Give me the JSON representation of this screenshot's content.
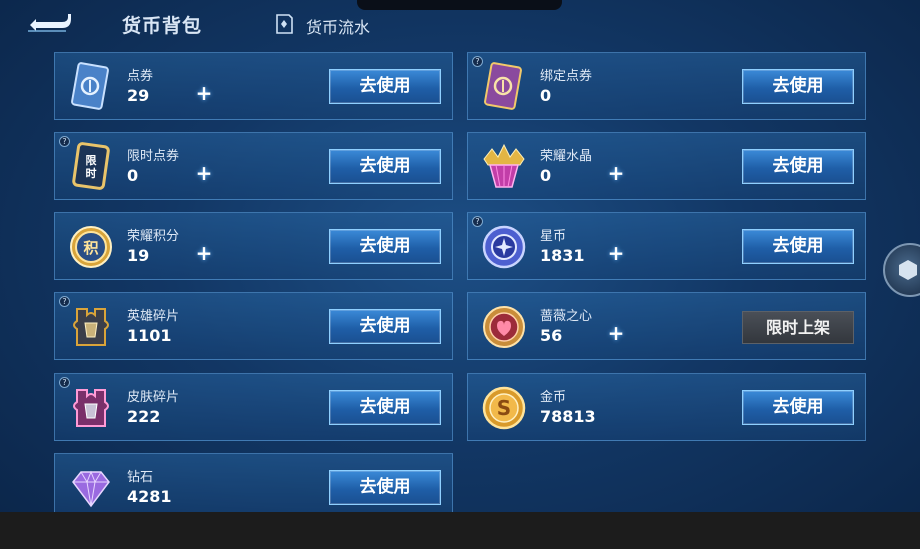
{
  "header": {
    "title": "货币背包",
    "flow_tab_label": "货币流水"
  },
  "colors": {
    "accent": "#3b8ad8",
    "background": "#123765",
    "limited_button": "#3f444b"
  },
  "currencies": [
    {
      "name": "点券",
      "amount": "29",
      "has_info": false,
      "has_plus": true,
      "button": "去使用",
      "icon": "ticket-card-icon"
    },
    {
      "name": "绑定点券",
      "amount": "0",
      "has_info": true,
      "has_plus": false,
      "button": "去使用",
      "icon": "bound-ticket-card-icon"
    },
    {
      "name": "限时点券",
      "amount": "0",
      "has_info": true,
      "has_plus": true,
      "button": "去使用",
      "icon": "limited-ticket-icon"
    },
    {
      "name": "荣耀水晶",
      "amount": "0",
      "has_info": false,
      "has_plus": true,
      "button": "去使用",
      "icon": "glory-crystal-icon"
    },
    {
      "name": "荣耀积分",
      "amount": "19",
      "has_info": false,
      "has_plus": true,
      "button": "去使用",
      "icon": "glory-points-coin-icon"
    },
    {
      "name": "星币",
      "amount": "1831",
      "has_info": true,
      "has_plus": true,
      "button": "去使用",
      "icon": "star-coin-icon"
    },
    {
      "name": "英雄碎片",
      "amount": "1101",
      "has_info": true,
      "has_plus": false,
      "button": "去使用",
      "icon": "hero-fragment-icon"
    },
    {
      "name": "蔷薇之心",
      "amount": "56",
      "has_info": false,
      "has_plus": true,
      "button": "限时上架",
      "icon": "rose-heart-coin-icon"
    },
    {
      "name": "皮肤碎片",
      "amount": "222",
      "has_info": true,
      "has_plus": false,
      "button": "去使用",
      "icon": "skin-fragment-icon"
    },
    {
      "name": "金币",
      "amount": "78813",
      "has_info": false,
      "has_plus": false,
      "button": "去使用",
      "icon": "gold-coin-icon"
    },
    {
      "name": "钻石",
      "amount": "4281",
      "has_info": false,
      "has_plus": false,
      "button": "去使用",
      "icon": "diamond-icon"
    }
  ]
}
